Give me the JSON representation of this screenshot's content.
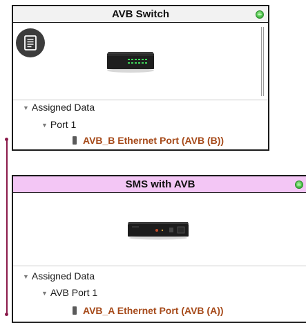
{
  "nodes": {
    "switch": {
      "title": "AVB Switch",
      "assigned_label": "Assigned Data",
      "port_group": "Port 1",
      "port_item": "AVB_B Ethernet Port (AVB (B))",
      "header_color": "#f2f2f2",
      "status": "green"
    },
    "sms": {
      "title": "SMS with AVB",
      "assigned_label": "Assigned Data",
      "port_group": "AVB Port 1",
      "port_item": "AVB_A Ethernet Port (AVB (A))",
      "header_color": "#f3c6f5",
      "status": "green"
    }
  },
  "icons": {
    "doc_badge": "document-icon",
    "expand": "disclosure-triangle-icon",
    "port": "ethernet-port-icon",
    "status": "status-indicator-icon"
  },
  "colors": {
    "port_text": "#a64a1a",
    "connector": "#8a1a4a",
    "status_green": "#4cc24a"
  }
}
